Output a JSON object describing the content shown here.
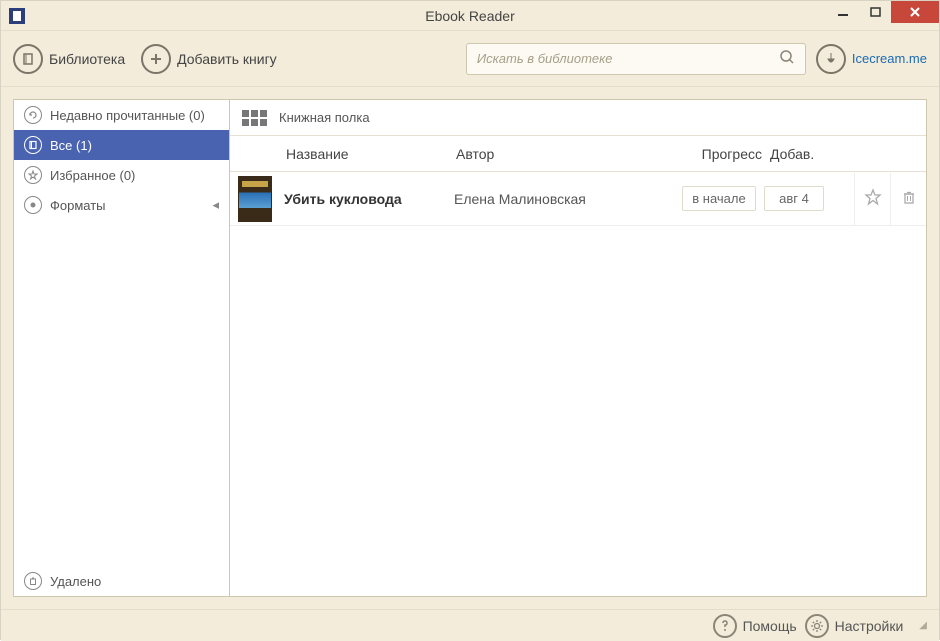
{
  "window": {
    "title": "Ebook Reader"
  },
  "toolbar": {
    "library_label": "Библиотека",
    "add_book_label": "Добавить книгу",
    "link_label": "Icecream.me"
  },
  "search": {
    "placeholder": "Искать в библиотеке"
  },
  "sidebar": {
    "items": [
      {
        "label": "Недавно прочитанные (0)"
      },
      {
        "label": "Все (1)"
      },
      {
        "label": "Избранное (0)"
      },
      {
        "label": "Форматы"
      }
    ],
    "deleted_label": "Удалено"
  },
  "shelf": {
    "header_label": "Книжная полка",
    "columns": {
      "title": "Название",
      "author": "Автор",
      "progress": "Прогресс",
      "added": "Добав."
    }
  },
  "books": [
    {
      "title": "Убить кукловода",
      "author": "Елена Малиновская",
      "progress": "в начале",
      "added": "авг 4"
    }
  ],
  "statusbar": {
    "help_label": "Помощь",
    "settings_label": "Настройки"
  }
}
